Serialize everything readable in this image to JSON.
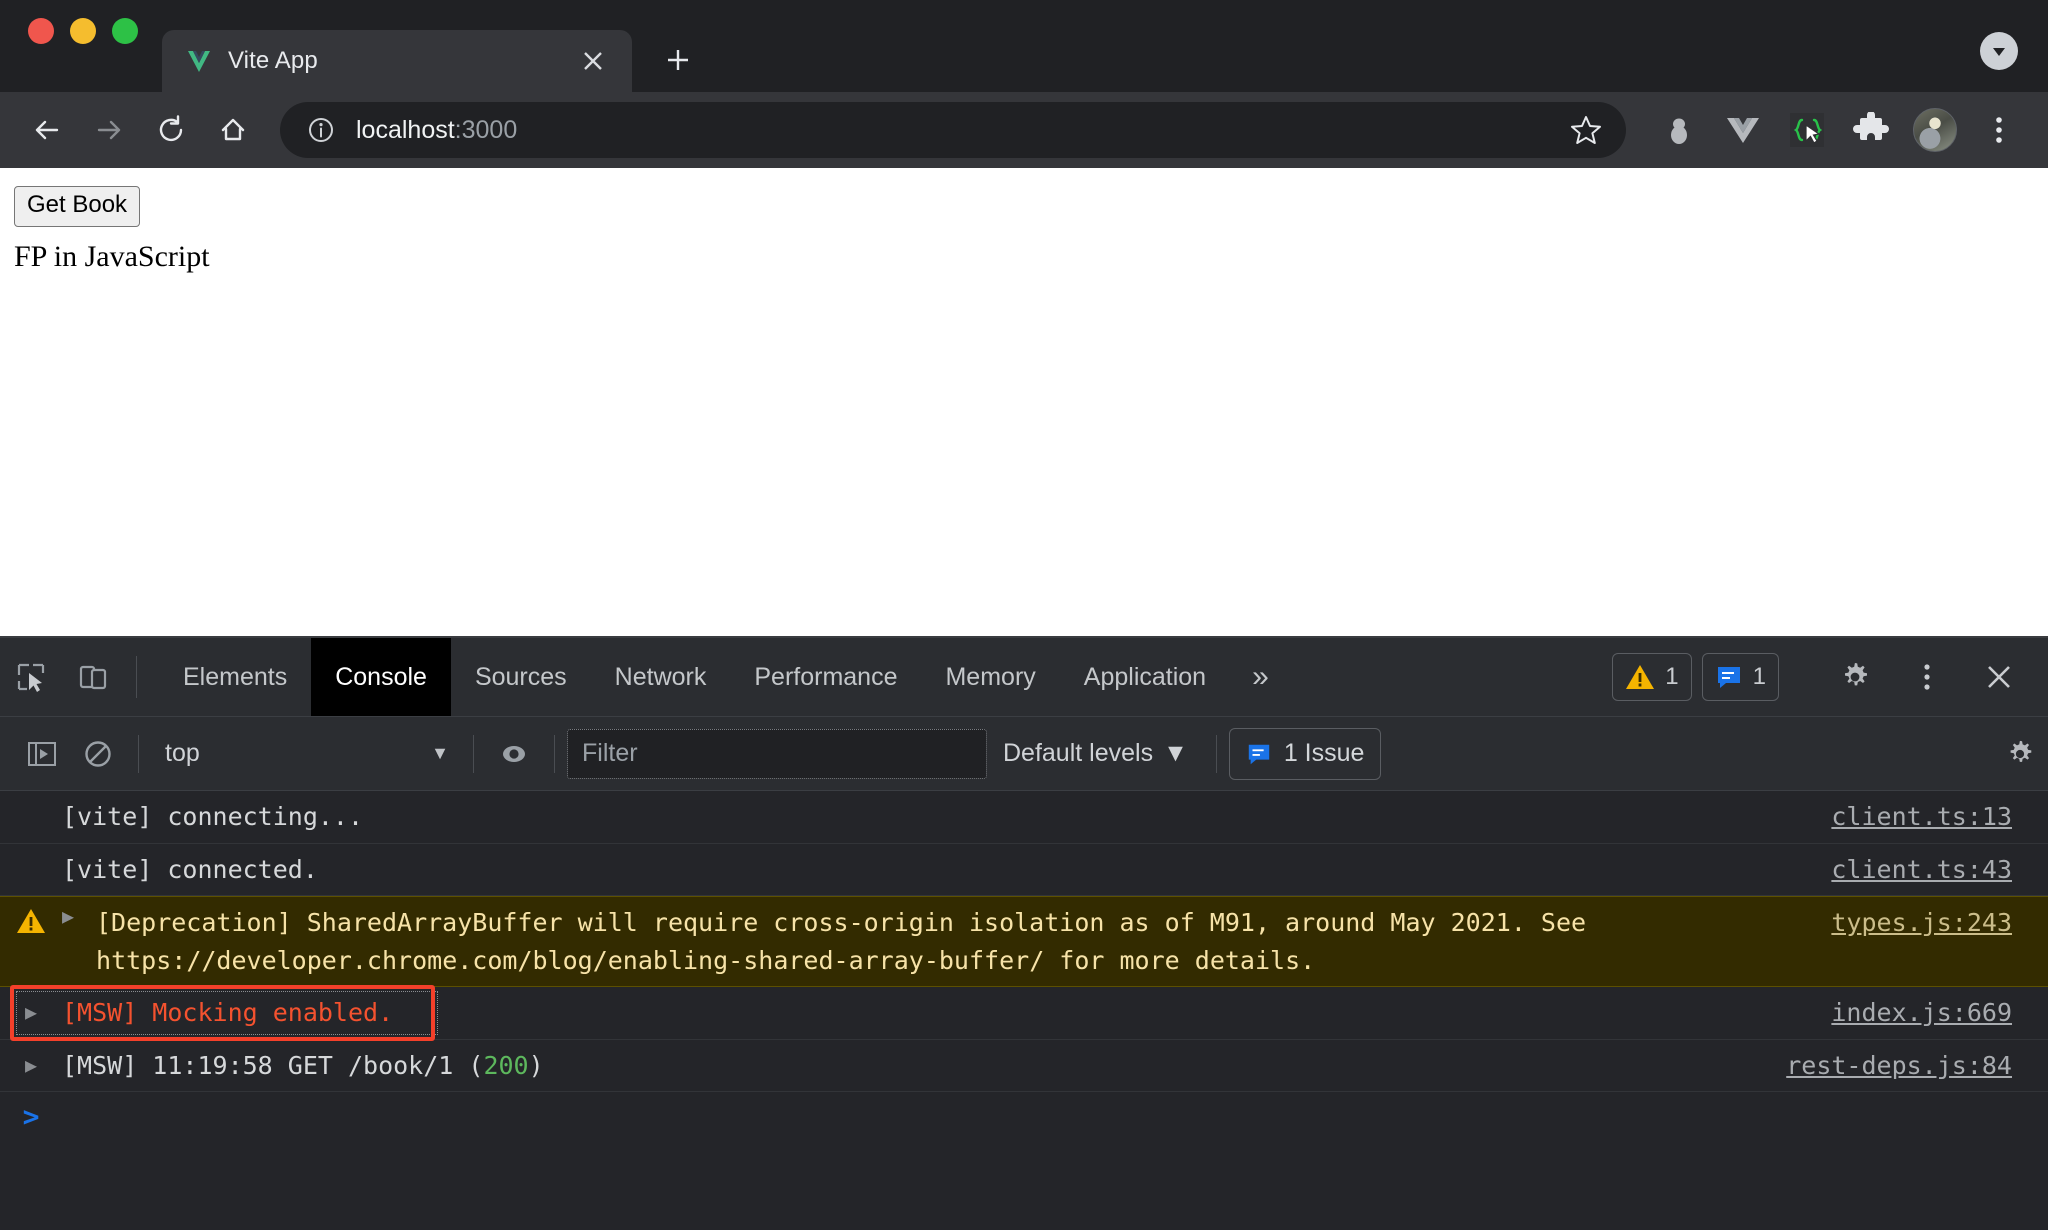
{
  "browser": {
    "window_controls": [
      "close",
      "minimize",
      "zoom"
    ],
    "tab": {
      "title": "Vite App",
      "favicon": "vite-logo-icon",
      "close_label": "×"
    },
    "new_tab_label": "+",
    "tab_search_label": "▼",
    "toolbar": {
      "back_label": "←",
      "forward_label": "→",
      "reload_label": "↻",
      "home_label": "⌂",
      "url_host": "localhost",
      "url_port": ":3000",
      "star_label": "☆",
      "extensions": [
        {
          "name": "bug-extension-icon",
          "label": ""
        },
        {
          "name": "vue-devtools-icon",
          "label": "V"
        },
        {
          "name": "msw-brackets-icon",
          "label": "{·}"
        },
        {
          "name": "puzzle-extensions-icon",
          "label": ""
        },
        {
          "name": "profile-avatar",
          "label": ""
        },
        {
          "name": "chrome-menu-icon",
          "label": "⋮"
        }
      ]
    }
  },
  "page": {
    "get_book_button": "Get Book",
    "book_title": "FP in JavaScript"
  },
  "devtools": {
    "tabs": [
      {
        "label": "Elements",
        "active": false
      },
      {
        "label": "Console",
        "active": true
      },
      {
        "label": "Sources",
        "active": false
      },
      {
        "label": "Network",
        "active": false
      },
      {
        "label": "Performance",
        "active": false
      },
      {
        "label": "Memory",
        "active": false
      },
      {
        "label": "Application",
        "active": false
      }
    ],
    "more_tabs_label": "»",
    "warning_badge": "1",
    "info_badge": "1",
    "settings_label": "⚙",
    "kebab_label": "⋮",
    "close_label": "✕",
    "console_toolbar": {
      "sidebar_toggle": "console-sidebar-toggle",
      "clear_console": "clear-console-icon",
      "context": "top",
      "context_caret": "▼",
      "live_expression": "eye-icon",
      "filter_placeholder": "Filter",
      "filter_value": "",
      "levels": "Default levels",
      "levels_caret": "▼",
      "issues": "1 Issue",
      "settings_label": "⚙"
    },
    "messages": [
      {
        "type": "log",
        "expandable": false,
        "text": "[vite] connecting...",
        "source": "client.ts:13"
      },
      {
        "type": "log",
        "expandable": false,
        "text": "[vite] connected.",
        "source": "client.ts:43"
      },
      {
        "type": "warning",
        "expandable": true,
        "text_before": "[Deprecation] SharedArrayBuffer will require cross-origin isolation as of M91, around May 2021. See h",
        "link_text": "ttps://developer.chrome.com/blog/enabling-shared-array-buffer/",
        "text_after": " for more details.",
        "source": "types.js:243"
      },
      {
        "type": "error",
        "expandable": true,
        "text": "[MSW] Mocking enabled.",
        "source": "index.js:669",
        "annotated": true
      },
      {
        "type": "log",
        "expandable": true,
        "text_before": "[MSW] 11:19:58 GET /book/1 (",
        "status": "200",
        "text_after": ")",
        "source": "rest-deps.js:84"
      }
    ],
    "prompt_symbol": ">"
  },
  "colors": {
    "accent_blue": "#1a73e8",
    "error_red": "#f4522f",
    "annotation_red": "#f4402a",
    "warning_bg": "#332b00",
    "warning_text": "#f7e3a8",
    "status_green": "#5db85d",
    "devtools_bg": "#242529",
    "chrome_bg": "#202124"
  }
}
